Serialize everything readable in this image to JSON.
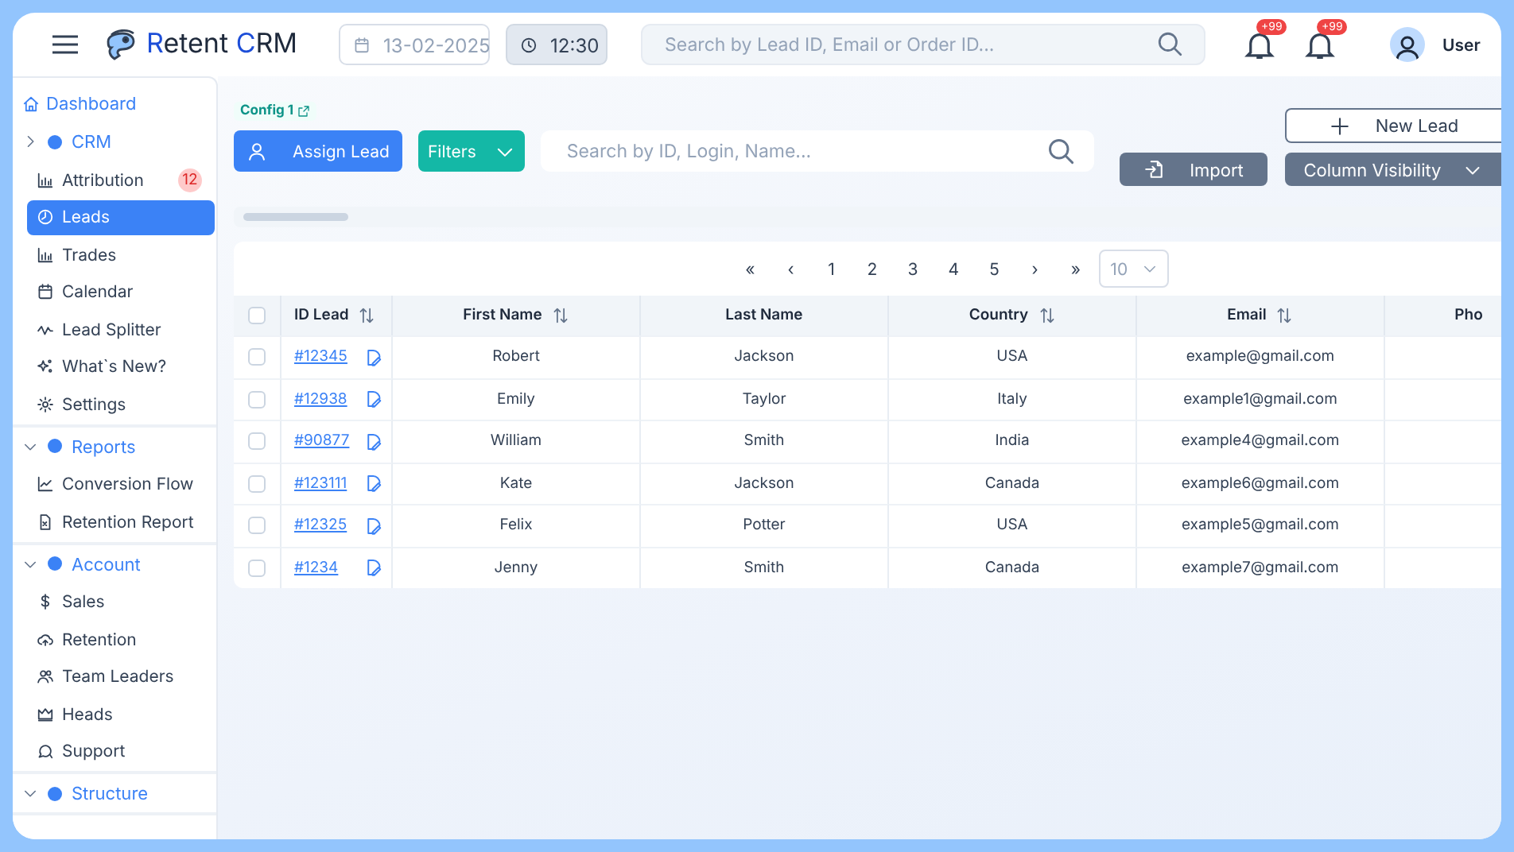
{
  "header": {
    "logo": "Retent CRM",
    "date": "13-02-2025",
    "time": "12:30",
    "search": {
      "placeholder": "Search by Lead ID, Email or Order ID..."
    },
    "notifications": [
      {
        "badge": "+99"
      },
      {
        "badge": "+99"
      }
    ],
    "user": "User"
  },
  "sidebar": {
    "dashboard": "Dashboard",
    "groups": [
      {
        "label": "CRM",
        "expanded": false,
        "items": [
          {
            "label": "Attribution",
            "badge": "12",
            "selected": false
          },
          {
            "label": "Leads",
            "selected": true
          },
          {
            "label": "Trades",
            "selected": false
          },
          {
            "label": "Calendar",
            "selected": false
          },
          {
            "label": "Lead Splitter",
            "selected": false
          },
          {
            "label": "What`s New?",
            "selected": false
          },
          {
            "label": "Settings",
            "selected": false
          }
        ]
      },
      {
        "label": "Reports",
        "expanded": true,
        "items": [
          {
            "label": "Conversion Flow",
            "selected": false
          },
          {
            "label": "Retention Report",
            "selected": false
          }
        ]
      },
      {
        "label": "Account",
        "expanded": true,
        "items": [
          {
            "label": "Sales",
            "selected": false
          },
          {
            "label": "Retention",
            "selected": false
          },
          {
            "label": "Team Leaders",
            "selected": false
          },
          {
            "label": "Heads",
            "selected": false
          },
          {
            "label": "Support",
            "selected": false
          }
        ]
      },
      {
        "label": "Structure",
        "expanded": true
      }
    ]
  },
  "main": {
    "config_link": "Config 1",
    "assign_button": "Assign Lead",
    "filters_button": "Filters",
    "search": {
      "placeholder": "Search by ID, Login, Name..."
    },
    "new_lead_button": "New Lead",
    "import_button": "Import",
    "column_visibility_button": "Column Visibility",
    "pagination": {
      "first": "«",
      "prev": "‹",
      "pages": [
        "1",
        "2",
        "3",
        "4",
        "5"
      ],
      "next": "›",
      "last": "»",
      "page_size": "10"
    },
    "table": {
      "select_all_checked": false,
      "columns": [
        {
          "label": "ID Lead",
          "sortable": true
        },
        {
          "label": "First Name",
          "sortable": true
        },
        {
          "label": "Last Name",
          "sortable": false
        },
        {
          "label": "Country",
          "sortable": true
        },
        {
          "label": "Email",
          "sortable": true
        },
        {
          "label": "Pho",
          "sortable": false
        }
      ],
      "rows": [
        {
          "checked": false,
          "id": "#12345",
          "first_name": "Robert",
          "last_name": "Jackson",
          "country": "USA",
          "email": "example@gmail.com"
        },
        {
          "checked": false,
          "id": "#12938",
          "first_name": "Emily",
          "last_name": "Taylor",
          "country": "Italy",
          "email": "example1@gmail.com"
        },
        {
          "checked": false,
          "id": "#90877",
          "first_name": "William",
          "last_name": "Smith",
          "country": "India",
          "email": "example4@gmail.com"
        },
        {
          "checked": false,
          "id": "#123111",
          "first_name": "Kate",
          "last_name": "Jackson",
          "country": "Canada",
          "email": "example6@gmail.com"
        },
        {
          "checked": false,
          "id": "#12325",
          "first_name": "Felix",
          "last_name": "Potter",
          "country": "USA",
          "email": "example5@gmail.com"
        },
        {
          "checked": false,
          "id": "#1234",
          "first_name": "Jenny",
          "last_name": "Smith",
          "country": "Canada",
          "email": "example7@gmail.com"
        }
      ]
    }
  }
}
